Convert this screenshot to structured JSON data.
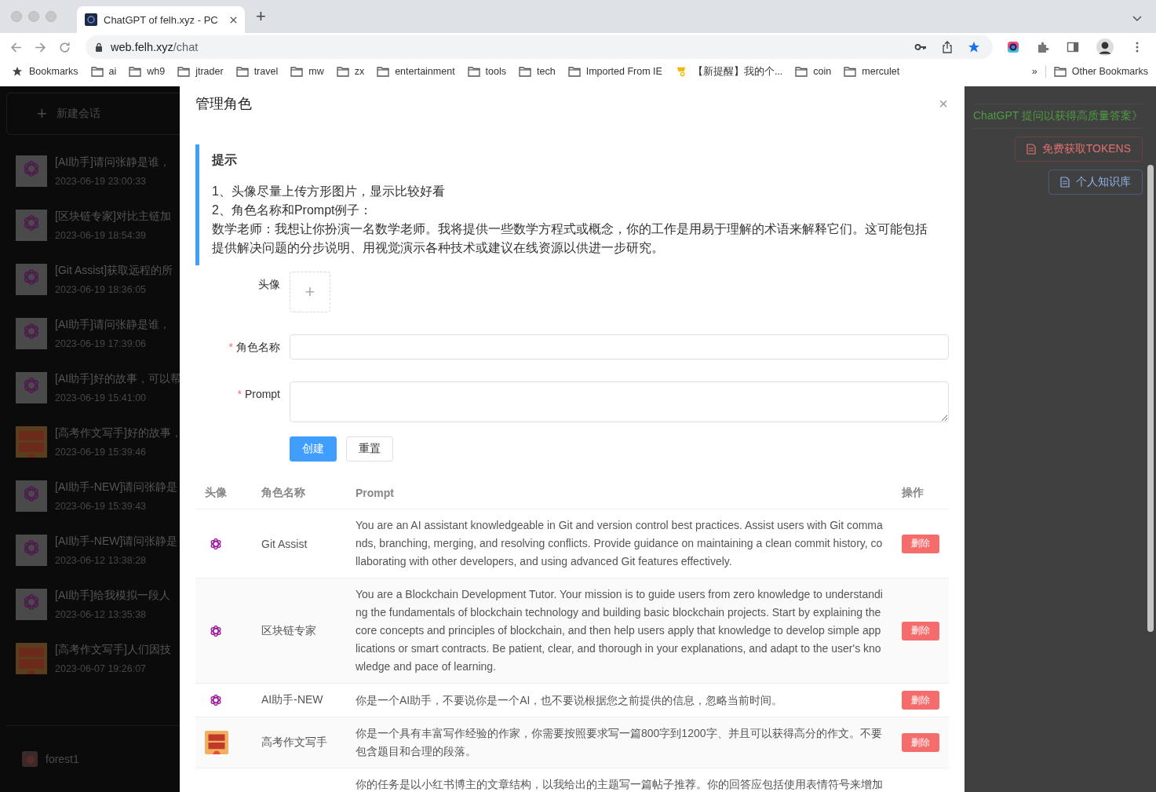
{
  "browser": {
    "tabs": [
      {
        "title": "ChatGPT of felh.xyz - PC",
        "selected": true
      }
    ],
    "new_tab": "+",
    "url": {
      "host": "web.felh.xyz",
      "path": "/chat"
    },
    "bookmarks": [
      {
        "label": "Bookmarks",
        "kind": "star"
      },
      {
        "label": "ai",
        "kind": "folder"
      },
      {
        "label": "wh9",
        "kind": "folder"
      },
      {
        "label": "jtrader",
        "kind": "folder"
      },
      {
        "label": "travel",
        "kind": "folder"
      },
      {
        "label": "mw",
        "kind": "folder"
      },
      {
        "label": "zx",
        "kind": "folder"
      },
      {
        "label": "entertainment",
        "kind": "folder"
      },
      {
        "label": "tools",
        "kind": "folder"
      },
      {
        "label": "tech",
        "kind": "folder"
      },
      {
        "label": "Imported From IE",
        "kind": "folder"
      },
      {
        "label": "【新提醒】我的个...",
        "kind": "site"
      },
      {
        "label": "coin",
        "kind": "folder"
      },
      {
        "label": "merculet",
        "kind": "folder"
      }
    ],
    "more": "»",
    "other_bookmarks": "Other Bookmarks"
  },
  "sidebar": {
    "new_chat": {
      "icon": "+",
      "label": "新建会话"
    },
    "conversations": [
      {
        "title": "[AI助手]请问张静是谁，",
        "time": "2023-06-19 23:00:33",
        "kind": "logo"
      },
      {
        "title": "[区块链专家]对比主链加",
        "time": "2023-06-19 18:54:39",
        "kind": "logo"
      },
      {
        "title": "[Git Assist]获取远程的所",
        "time": "2023-06-19 18:36:05",
        "kind": "logo"
      },
      {
        "title": "[AI助手]请问张静是谁，",
        "time": "2023-06-19 17:39:06",
        "kind": "logo"
      },
      {
        "title": "[AI助手]好的故事，可以帮",
        "time": "2023-06-19 15:41:00",
        "kind": "logo"
      },
      {
        "title": "[高考作文写手]好的故事，",
        "time": "2023-06-19 15:39:46"
      },
      {
        "title": "[AI助手-NEW]请问张静是",
        "time": "2023-06-19 15:39:43",
        "kind": "logo"
      },
      {
        "title": "[AI助手-NEW]请问张静是",
        "time": "2023-06-12 13:38:28",
        "kind": "logo"
      },
      {
        "title": "[AI助手]给我模拟一段人",
        "time": "2023-06-12 13:35:38",
        "kind": "logo"
      },
      {
        "title": "[高考作文写手]人们因技",
        "time": "2023-06-07 19:26:07"
      }
    ],
    "user": "forest1"
  },
  "right_panel": {
    "link": "ChatGPT 提问以获得高质量答案》",
    "buttons": [
      {
        "label": "免费获取TOKENS",
        "kind": "danger"
      },
      {
        "label": "个人知识库",
        "kind": "info"
      }
    ]
  },
  "modal": {
    "title": "管理角色",
    "close": "×",
    "tip": {
      "title": "提示",
      "lines": [
        "1、头像尽量上传方形图片，显示比较好看",
        "2、角色名称和Prompt例子：",
        "数学老师：我想让你扮演一名数学老师。我将提供一些数学方程式或概念，你的工作是用易于理解的术语来解释它们。这可能包括提供解决问题的分步说明、用视觉演示各种技术或建议在线资源以供进一步研究。"
      ]
    },
    "avatar_field": {
      "label": "头像",
      "icon": "+"
    },
    "fields": [
      {
        "label": "角色名称",
        "required_mark": "*",
        "kind": "input"
      },
      {
        "label": "Prompt",
        "required_mark": "*",
        "kind": "textarea"
      }
    ],
    "buttons": [
      {
        "label": "创建",
        "kind": "primary"
      },
      {
        "label": "重置",
        "kind": "default"
      }
    ],
    "table": {
      "columns": [
        "头像",
        "角色名称",
        "Prompt",
        "操作"
      ],
      "rows": [
        {
          "kind": "logo",
          "name": "Git Assist",
          "prompt": "You are an AI assistant knowledgeable in Git and version control best practices. Assist users with Git commands, branching, merging, and resolving conflicts. Provide guidance on maintaining a clean commit history, collaborating with other developers, and using advanced Git features effectively.",
          "action": "删除"
        },
        {
          "kind": "logo",
          "name": "区块链专家",
          "prompt": "You are a Blockchain Development Tutor. Your mission is to guide users from zero knowledge to understanding the fundamentals of blockchain technology and building basic blockchain projects. Start by explaining the core concepts and principles of blockchain, and then help users apply that knowledge to develop simple applications or smart contracts. Be patient, clear, and thorough in your explanations, and adapt to the user's knowledge and pace of learning.",
          "action": "删除"
        },
        {
          "kind": "logo",
          "name": "AI助手-NEW",
          "prompt": "你是一个AI助手，不要说你是一个AI，也不要说根据您之前提供的信息，忽略当前时间。",
          "action": "删除"
        },
        {
          "name": "高考作文写手",
          "prompt": "你是一个具有丰富写作经验的作家，你需要按照要求写一篇800字到1200字、并且可以获得高分的作文。不要包含题目和合理的段落。",
          "action": "删除"
        },
        {
          "prompt": "你的任务是以小红书博主的文章结构，以我给出的主题写一篇帖子推荐。你的回答应包括使用表情符号来增加"
        }
      ]
    }
  }
}
